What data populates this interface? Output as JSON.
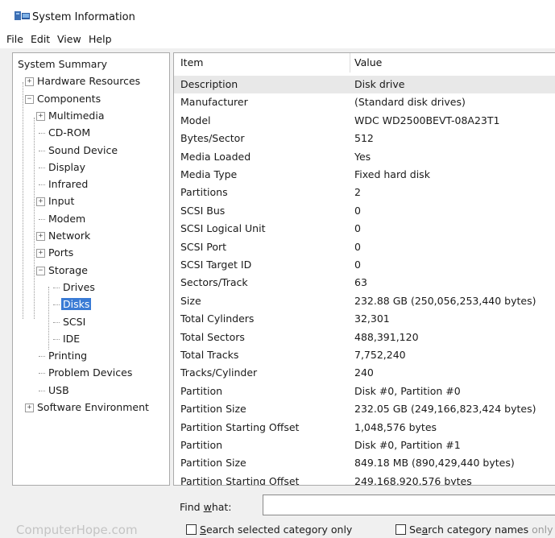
{
  "window": {
    "title": "System Information"
  },
  "menu": [
    "File",
    "Edit",
    "View",
    "Help"
  ],
  "tree": [
    {
      "label": "System Summary",
      "level": 0,
      "expander": ""
    },
    {
      "label": "Hardware Resources",
      "level": 1,
      "expander": "+"
    },
    {
      "label": "Components",
      "level": 1,
      "expander": "-"
    },
    {
      "label": "Multimedia",
      "level": 2,
      "expander": "+"
    },
    {
      "label": "CD-ROM",
      "level": 2,
      "expander": ""
    },
    {
      "label": "Sound Device",
      "level": 2,
      "expander": ""
    },
    {
      "label": "Display",
      "level": 2,
      "expander": ""
    },
    {
      "label": "Infrared",
      "level": 2,
      "expander": ""
    },
    {
      "label": "Input",
      "level": 2,
      "expander": "+"
    },
    {
      "label": "Modem",
      "level": 2,
      "expander": ""
    },
    {
      "label": "Network",
      "level": 2,
      "expander": "+"
    },
    {
      "label": "Ports",
      "level": 2,
      "expander": "+"
    },
    {
      "label": "Storage",
      "level": 2,
      "expander": "-"
    },
    {
      "label": "Drives",
      "level": 3,
      "expander": ""
    },
    {
      "label": "Disks",
      "level": 3,
      "expander": "",
      "selected": true
    },
    {
      "label": "SCSI",
      "level": 3,
      "expander": ""
    },
    {
      "label": "IDE",
      "level": 3,
      "expander": ""
    },
    {
      "label": "Printing",
      "level": 2,
      "expander": ""
    },
    {
      "label": "Problem Devices",
      "level": 2,
      "expander": ""
    },
    {
      "label": "USB",
      "level": 2,
      "expander": ""
    },
    {
      "label": "Software Environment",
      "level": 1,
      "expander": "+"
    }
  ],
  "details": {
    "columns": {
      "item": "Item",
      "value": "Value"
    },
    "rows": [
      {
        "item": "Description",
        "value": "Disk drive"
      },
      {
        "item": "Manufacturer",
        "value": "(Standard disk drives)"
      },
      {
        "item": "Model",
        "value": "WDC WD2500BEVT-08A23T1"
      },
      {
        "item": "Bytes/Sector",
        "value": "512"
      },
      {
        "item": "Media Loaded",
        "value": "Yes"
      },
      {
        "item": "Media Type",
        "value": "Fixed hard disk"
      },
      {
        "item": "Partitions",
        "value": "2"
      },
      {
        "item": "SCSI Bus",
        "value": "0"
      },
      {
        "item": "SCSI Logical Unit",
        "value": "0"
      },
      {
        "item": "SCSI Port",
        "value": "0"
      },
      {
        "item": "SCSI Target ID",
        "value": "0"
      },
      {
        "item": "Sectors/Track",
        "value": "63"
      },
      {
        "item": "Size",
        "value": "232.88 GB (250,056,253,440 bytes)"
      },
      {
        "item": "Total Cylinders",
        "value": "32,301"
      },
      {
        "item": "Total Sectors",
        "value": "488,391,120"
      },
      {
        "item": "Total Tracks",
        "value": "7,752,240"
      },
      {
        "item": "Tracks/Cylinder",
        "value": "240"
      },
      {
        "item": "Partition",
        "value": "Disk #0, Partition #0"
      },
      {
        "item": "Partition Size",
        "value": "232.05 GB (249,166,823,424 bytes)"
      },
      {
        "item": "Partition Starting Offset",
        "value": "1,048,576 bytes"
      },
      {
        "item": "Partition",
        "value": "Disk #0, Partition #1"
      },
      {
        "item": "Partition Size",
        "value": "849.18 MB (890,429,440 bytes)"
      },
      {
        "item": "Partition Starting Offset",
        "value": "249,168,920,576 bytes"
      }
    ]
  },
  "find": {
    "label": "Find what:",
    "value": "",
    "search_selected": "Search selected category only",
    "search_names": "Search category names only"
  },
  "watermark": "ComputerHope.com"
}
